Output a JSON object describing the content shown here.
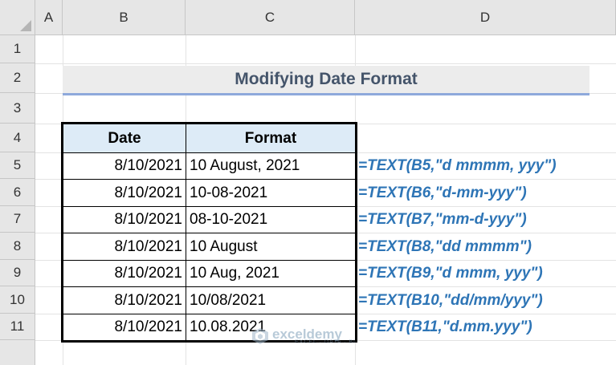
{
  "columns": [
    "A",
    "B",
    "C",
    "D"
  ],
  "rows": [
    "1",
    "2",
    "3",
    "4",
    "5",
    "6",
    "7",
    "8",
    "9",
    "10",
    "11"
  ],
  "title": "Modifying Date Format",
  "table": {
    "headers": [
      "Date",
      "Format"
    ],
    "rows": [
      {
        "date": "8/10/2021",
        "format": "10 August, 2021",
        "formula": "=TEXT(B5,\"d mmmm, yyy\")"
      },
      {
        "date": "8/10/2021",
        "format": "10-08-2021",
        "formula": "=TEXT(B6,\"d-mm-yyy\")"
      },
      {
        "date": "8/10/2021",
        "format": "08-10-2021",
        "formula": "=TEXT(B7,\"mm-d-yyy\")"
      },
      {
        "date": "8/10/2021",
        "format": "10 August",
        "formula": "=TEXT(B8,\"dd mmmm\")"
      },
      {
        "date": "8/10/2021",
        "format": "10 Aug, 2021",
        "formula": "=TEXT(B9,\"d mmm, yyy\")"
      },
      {
        "date": "8/10/2021",
        "format": "10/08/2021",
        "formula": "=TEXT(B10,\"dd/mm/yyy\")"
      },
      {
        "date": "8/10/2021",
        "format": "10.08.2021",
        "formula": "=TEXT(B11,\"d.mm.yyy\")"
      }
    ]
  },
  "watermark": {
    "name": "exceldemy",
    "tagline": "EXCEL · DATA · BI"
  },
  "colors": {
    "header_bg": "#e6e6e6",
    "table_header_bg": "#ddebf7",
    "formula": "#2e75b6",
    "title": "#44546a"
  }
}
